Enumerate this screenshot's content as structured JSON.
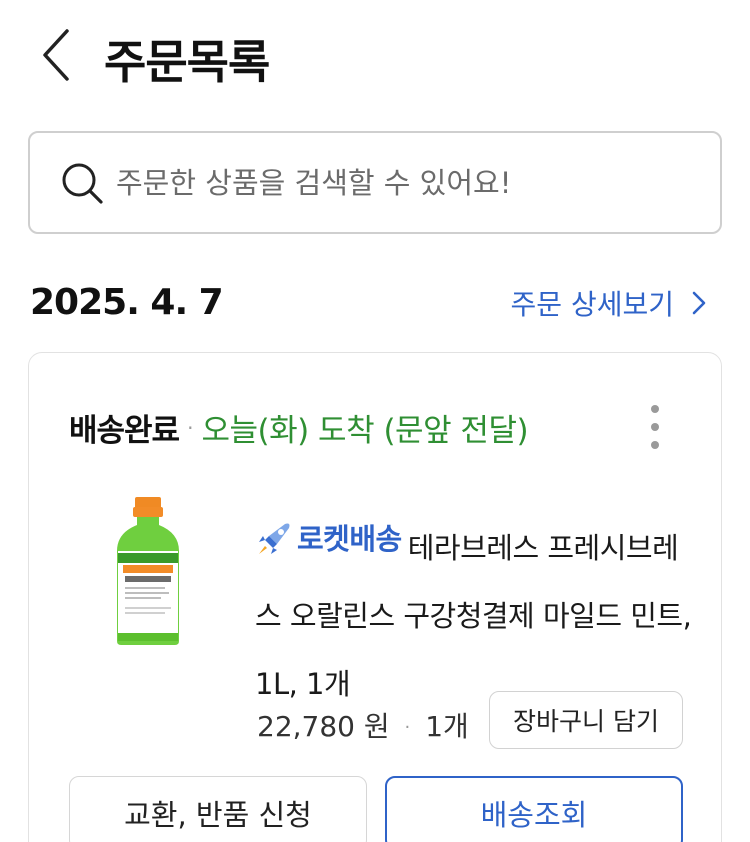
{
  "header": {
    "back_icon": "chevron-left-icon",
    "title": "주문목록"
  },
  "search": {
    "icon": "search-icon",
    "placeholder": "주문한 상품을 검색할 수 있어요!",
    "value": ""
  },
  "order": {
    "date": "2025. 4. 7",
    "detail_link_label": "주문 상세보기",
    "detail_link_icon": "chevron-right-icon",
    "status": "배송완료",
    "status_separator": "·",
    "delivery_info": "오늘(화) 도착 (문앞 전달)",
    "more_icon": "more-vertical-icon",
    "product": {
      "image_icon": "mouthwash-bottle-image",
      "badge_icon": "rocket-icon",
      "badge_label": "로켓배송",
      "name": "테라브레스 프레시브레스 오랄린스 구강청결제 마일드 민트, 1L, 1개",
      "price": "22,780 원",
      "separator": "·",
      "quantity": "1개",
      "cart_button_label": "장바구니 담기"
    },
    "actions": {
      "exchange_return_label": "교환, 반품 신청",
      "track_delivery_label": "배송조회"
    }
  },
  "colors": {
    "accent_blue": "#2f63c8",
    "delivery_green": "#2f8f33",
    "border_gray": "#cfcfcf"
  }
}
